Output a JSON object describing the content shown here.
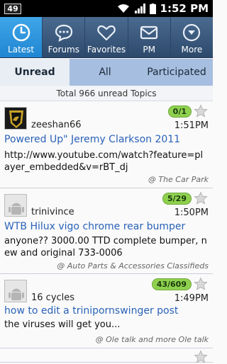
{
  "status_bar": {
    "notification_count": "49",
    "time": "1:52 PM"
  },
  "tabs": [
    {
      "label": "Latest",
      "icon": "clock-icon",
      "active": true
    },
    {
      "label": "Forums",
      "icon": "chat-bubble-icon",
      "active": false
    },
    {
      "label": "Favorites",
      "icon": "heart-icon",
      "active": false
    },
    {
      "label": "PM",
      "icon": "envelope-icon",
      "active": false
    },
    {
      "label": "More",
      "icon": "chevron-down-circle-icon",
      "active": false
    }
  ],
  "filter": {
    "options": [
      "Unread",
      "All",
      "Participated"
    ],
    "selected": "Unread"
  },
  "total_text": "Total 966 unread Topics",
  "topics": [
    {
      "author": "zeeshan66",
      "badge": "0/1",
      "time": "1:51PM",
      "title": "Powered Up\" Jeremy Clarkson 2011",
      "body": "http://www.youtube.com/watch?feature=player_embedded&v=rBT_dj",
      "forum": "@ The Car Park"
    },
    {
      "author": "trinivince",
      "badge": "5/29",
      "time": "1:50PM",
      "title": "WTB Hilux vigo chrome rear bumper",
      "body": " anyone??  3000.00 TTD complete bumper, new and original 733-0006",
      "forum": "@ Auto Parts & Accessories Classifieds"
    },
    {
      "author": "16 cycles",
      "badge": "43/609",
      "time": "1:49PM",
      "title": "how to edit a trinipornswinger post",
      "body": "the viruses will get you...",
      "forum": "@ Ole talk and more Ole talk"
    }
  ],
  "colors": {
    "tab_active": "#1f86d2",
    "tab_bar": "#3b5a7e",
    "link": "#2a62b8",
    "badge": "#8fd14f"
  }
}
